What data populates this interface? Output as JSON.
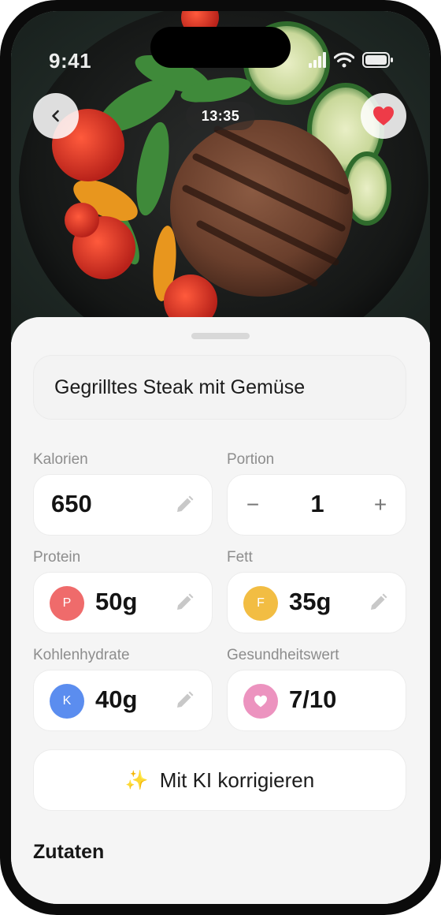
{
  "status": {
    "time": "9:41"
  },
  "hero": {
    "timer": "13:35",
    "back_icon": "chevron-left-icon",
    "favorite_icon": "heart-icon",
    "favorite_color": "#ee3b48"
  },
  "meal": {
    "title": "Gegrilltes Steak mit Gemüse"
  },
  "fields": {
    "calories": {
      "label": "Kalorien",
      "value": "650"
    },
    "portion": {
      "label": "Portion",
      "value": "1",
      "minus": "−",
      "plus": "+"
    },
    "protein": {
      "label": "Protein",
      "badge": "P",
      "value": "50g",
      "color": "#ef6b6b"
    },
    "fat": {
      "label": "Fett",
      "badge": "F",
      "value": "35g",
      "color": "#f2bd43"
    },
    "carbs": {
      "label": "Kohlenhydrate",
      "badge": "K",
      "value": "40g",
      "color": "#5b8def"
    },
    "health": {
      "label": "Gesundheitswert",
      "value": "7/10",
      "color": "#ec93bf"
    }
  },
  "actions": {
    "ai_correct": "Mit KI korrigieren",
    "ai_icon": "✨"
  },
  "sections": {
    "ingredients": "Zutaten"
  }
}
